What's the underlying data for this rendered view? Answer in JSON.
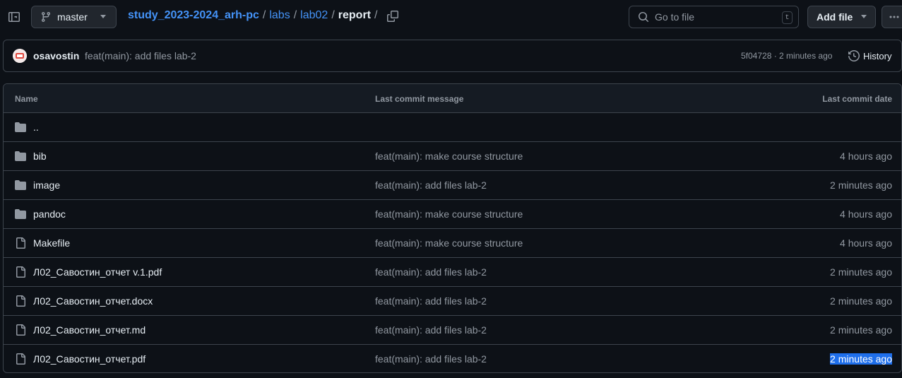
{
  "header": {
    "branch": "master",
    "breadcrumb": {
      "repo": "study_2023-2024_arh-pc",
      "labs": "labs",
      "lab": "lab02",
      "current": "report",
      "sep": "/"
    },
    "goto_placeholder": "Go to file",
    "goto_shortcut": "t",
    "add_file": "Add file"
  },
  "commit": {
    "author": "osavostin",
    "message": "feat(main): add files lab-2",
    "meta": "5f04728 · 2 minutes ago",
    "history_label": "History"
  },
  "table": {
    "headers": {
      "name": "Name",
      "message": "Last commit message",
      "date": "Last commit date"
    },
    "rows": [
      {
        "type": "folder",
        "name": "..",
        "message": "",
        "date": ""
      },
      {
        "type": "folder",
        "name": "bib",
        "message": "feat(main): make course structure",
        "date": "4 hours ago"
      },
      {
        "type": "folder",
        "name": "image",
        "message": "feat(main): add files lab-2",
        "date": "2 minutes ago"
      },
      {
        "type": "folder",
        "name": "pandoc",
        "message": "feat(main): make course structure",
        "date": "4 hours ago"
      },
      {
        "type": "file",
        "name": "Makefile",
        "message": "feat(main): make course structure",
        "date": "4 hours ago"
      },
      {
        "type": "file",
        "name": "Л02_Савостин_отчет v.1.pdf",
        "message": "feat(main): add files lab-2",
        "date": "2 minutes ago"
      },
      {
        "type": "file",
        "name": "Л02_Савостин_отчет.docx",
        "message": "feat(main): add files lab-2",
        "date": "2 minutes ago"
      },
      {
        "type": "file",
        "name": "Л02_Савостин_отчет.md",
        "message": "feat(main): add files lab-2",
        "date": "2 minutes ago"
      },
      {
        "type": "file",
        "name": "Л02_Савостин_отчет.pdf",
        "message": "feat(main): add files lab-2",
        "date": "2 minutes ago",
        "selected": true
      }
    ]
  },
  "colors": {
    "background": "#0d1117",
    "link": "#4493f8",
    "muted": "#9198a1",
    "selection": "#1f6feb"
  }
}
